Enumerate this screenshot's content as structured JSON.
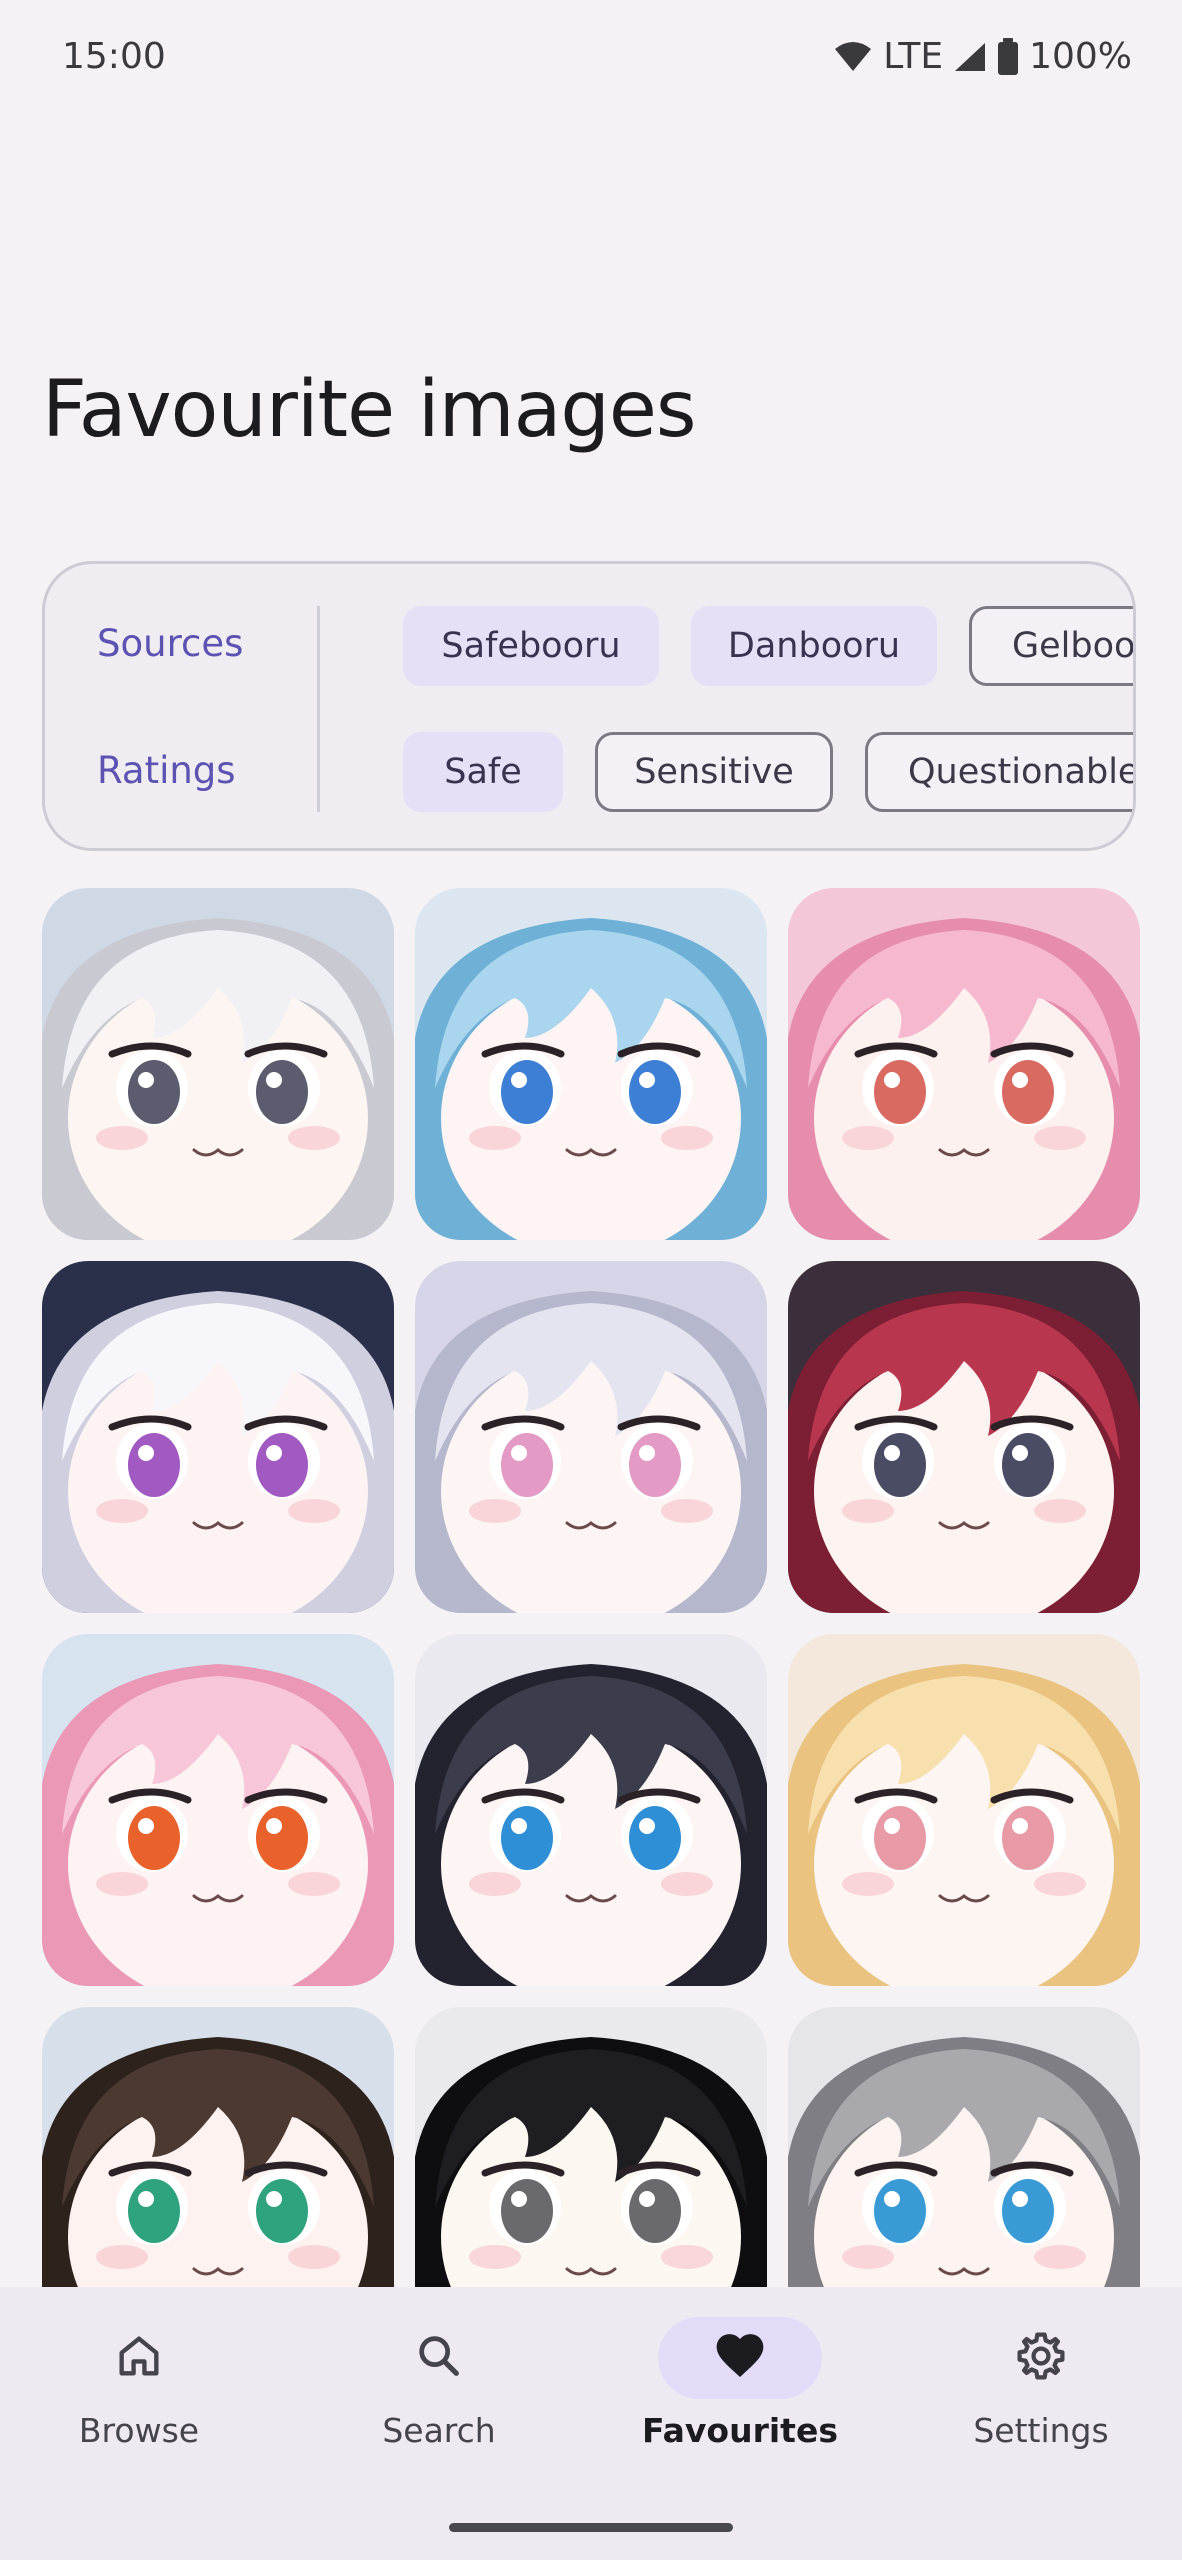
{
  "status_bar": {
    "time": "15:00",
    "network": "LTE",
    "battery": "100%"
  },
  "page": {
    "title": "Favourite images"
  },
  "filters": {
    "sources_label": "Sources",
    "ratings_label": "Ratings",
    "sources": [
      {
        "label": "Safebooru",
        "selected": true
      },
      {
        "label": "Danbooru",
        "selected": true
      },
      {
        "label": "Gelbooru",
        "selected": false
      }
    ],
    "ratings": [
      {
        "label": "Safe",
        "selected": true
      },
      {
        "label": "Sensitive",
        "selected": false
      },
      {
        "label": "Questionable",
        "selected": false
      }
    ]
  },
  "images": [
    {
      "hair": "#f1f1f5",
      "hair_dark": "#c9c9d2",
      "eye": "#5c5c6e",
      "bg": "#cfd9e6",
      "skin": "#fdf5f2"
    },
    {
      "hair": "#a9d6ee",
      "hair_dark": "#6fb1d6",
      "eye": "#3c7fd4",
      "bg": "#dbe6f1",
      "skin": "#fdf4f3"
    },
    {
      "hair": "#f6b8cf",
      "hair_dark": "#e68cad",
      "eye": "#d96a62",
      "bg": "#f3c7d8",
      "skin": "#fdf1ef"
    },
    {
      "hair": "#f7f7fb",
      "hair_dark": "#cfcfe0",
      "eye": "#a15ac2",
      "bg": "#2a2f4a",
      "skin": "#fdf3f3"
    },
    {
      "hair": "#e3e4ef",
      "hair_dark": "#b5b7cc",
      "eye": "#e39ac5",
      "bg": "#d6d5e8",
      "skin": "#fdf4f4"
    },
    {
      "hair": "#b8364e",
      "hair_dark": "#7c1f34",
      "eye": "#4a4c64",
      "bg": "#3a2f3a",
      "skin": "#fdf3f1"
    },
    {
      "hair": "#f7c6d8",
      "hair_dark": "#ea98b6",
      "eye": "#e9622c",
      "bg": "#d7e3ef",
      "skin": "#fdf3f3"
    },
    {
      "hair": "#3b3c4c",
      "hair_dark": "#23232f",
      "eye": "#2f8fd6",
      "bg": "#e9e9ef",
      "skin": "#fdf5f4"
    },
    {
      "hair": "#f8dfae",
      "hair_dark": "#e9c37f",
      "eye": "#e89aa6",
      "bg": "#f4e8dc",
      "skin": "#fdf5f2"
    },
    {
      "hair": "#4c3a32",
      "hair_dark": "#2e221d",
      "eye": "#2ea37d",
      "bg": "#d7e0ea",
      "skin": "#fdf2f0"
    },
    {
      "hair": "#1e1e22",
      "hair_dark": "#0e0e10",
      "eye": "#6a6a6e",
      "bg": "#eaeaee",
      "skin": "#fdf7f2"
    },
    {
      "hair": "#a9a9ad",
      "hair_dark": "#7e7e84",
      "eye": "#3a9ad6",
      "bg": "#e5e5ea",
      "skin": "#fdf4f2"
    }
  ],
  "bottom_nav": [
    {
      "label": "Browse",
      "icon": "home-icon",
      "active": false
    },
    {
      "label": "Search",
      "icon": "search-icon",
      "active": false
    },
    {
      "label": "Favourites",
      "icon": "heart-icon",
      "active": true
    },
    {
      "label": "Settings",
      "icon": "gear-icon",
      "active": false
    }
  ]
}
